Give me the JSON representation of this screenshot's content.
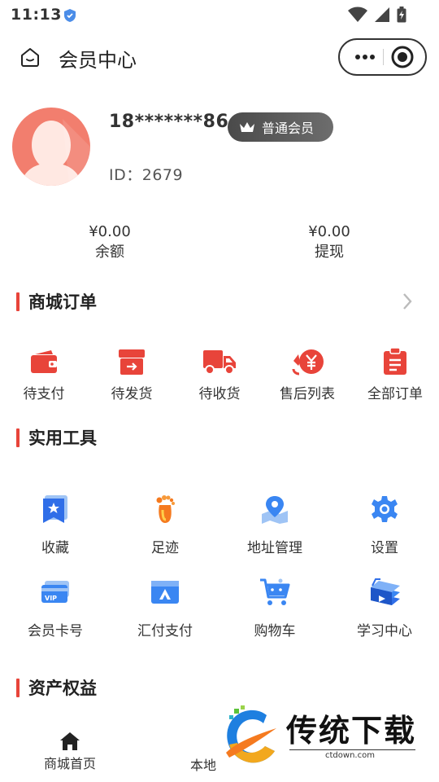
{
  "status": {
    "time": "11:13"
  },
  "header": {
    "title": "会员中心"
  },
  "profile": {
    "phone": "18*******86",
    "badge": "普通会员",
    "id": "ID：2679"
  },
  "balance": [
    {
      "amount": "¥0.00",
      "label": "余额"
    },
    {
      "amount": "¥0.00",
      "label": "提现"
    }
  ],
  "orders": {
    "title": "商城订单",
    "items": [
      {
        "label": "待支付",
        "icon": "wallet-icon"
      },
      {
        "label": "待发货",
        "icon": "box-icon"
      },
      {
        "label": "待收货",
        "icon": "truck-icon"
      },
      {
        "label": "售后列表",
        "icon": "refund-icon"
      },
      {
        "label": "全部订单",
        "icon": "clipboard-icon"
      }
    ]
  },
  "tools": {
    "title": "实用工具",
    "items": [
      {
        "label": "收藏",
        "icon": "star-bookmark-icon"
      },
      {
        "label": "足迹",
        "icon": "footprint-icon"
      },
      {
        "label": "地址管理",
        "icon": "map-pin-icon"
      },
      {
        "label": "设置",
        "icon": "gear-icon"
      },
      {
        "label": "会员卡号",
        "icon": "vip-card-icon"
      },
      {
        "label": "汇付支付",
        "icon": "payment-card-icon"
      },
      {
        "label": "购物车",
        "icon": "cart-icon"
      },
      {
        "label": "学习中心",
        "icon": "books-icon"
      }
    ]
  },
  "assets": {
    "title": "资产权益"
  },
  "tabbar": {
    "home": "商城首页",
    "local": "本地"
  },
  "watermark": {
    "text": "传统下载",
    "url": "ctdown.com"
  },
  "colors": {
    "accent": "#e8443a",
    "icon_blue": "#3a86f2",
    "badge_bg": "#555555",
    "avatar_bg": "#f27e6e"
  }
}
